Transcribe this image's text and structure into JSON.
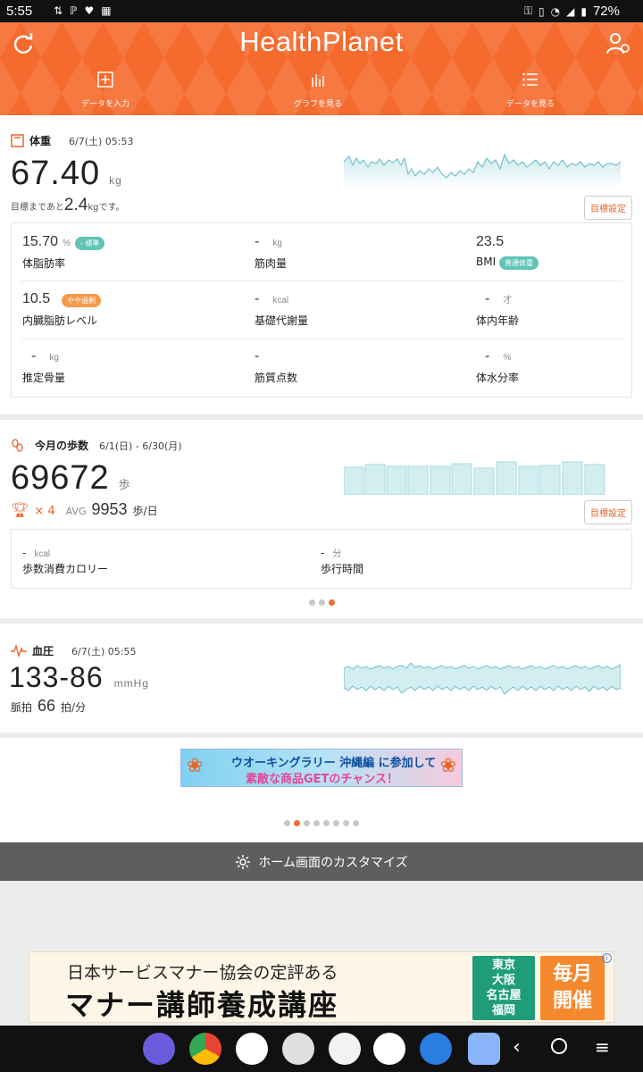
{
  "status_bar": {
    "time": "5:55",
    "battery": "72%"
  },
  "header": {
    "brand": "HealthPlanet",
    "nav": [
      {
        "label": "データを入力"
      },
      {
        "label": "グラフを見る"
      },
      {
        "label": "データを見る"
      }
    ]
  },
  "weight": {
    "title": "体重",
    "date": "6/7(土) 05:53",
    "value": "67.40",
    "unit": "kg",
    "goal_prefix": "目標まであと",
    "goal_value": "2.4",
    "goal_unit": "kg",
    "goal_suffix": "です。",
    "goal_button": "目標設定",
    "metrics": [
      {
        "value": "15.70",
        "unit": "%",
        "badge": "- 標準",
        "label": "体脂肪率"
      },
      {
        "value": "-",
        "unit": "kg",
        "label": "筋肉量"
      },
      {
        "value": "23.5",
        "unit": "",
        "label": "BMI",
        "badge": "普通体重"
      },
      {
        "value": "10.5",
        "unit": "",
        "badge": "やや過剰",
        "label": "内臓脂肪レベル"
      },
      {
        "value": "-",
        "unit": "kcal",
        "label": "基礎代謝量"
      },
      {
        "value": "-",
        "unit": "才",
        "label": "体内年齢"
      },
      {
        "value": "-",
        "unit": "kg",
        "label": "推定骨量"
      },
      {
        "value": "-",
        "unit": "",
        "label": "筋質点数"
      },
      {
        "value": "-",
        "unit": "%",
        "label": "体水分率"
      }
    ]
  },
  "steps": {
    "title": "今月の歩数",
    "date": "6/1(日) - 6/30(月)",
    "value": "69672",
    "unit": "歩",
    "trophy_count": "× 4",
    "avg_label": "AVG",
    "avg_value": "9953",
    "avg_unit": "歩/日",
    "goal_button": "目標設定",
    "metrics": [
      {
        "value": "-",
        "unit": "kcal",
        "label": "歩数消費カロリー"
      },
      {
        "value": "-",
        "unit": "分",
        "label": "歩行時間"
      }
    ]
  },
  "blood_pressure": {
    "title": "血圧",
    "date": "6/7(土) 05:55",
    "value": "133-86",
    "unit": "mmHg",
    "pulse_label": "脈拍",
    "pulse_value": "66",
    "pulse_unit": "拍/分"
  },
  "ad_small": {
    "line1": "ウオーキングラリー 沖縄編 に参加して",
    "line2": "素敵な商品GETのチャンス！"
  },
  "customize": {
    "label": "ホーム画面のカスタマイズ"
  },
  "ad_banner": {
    "line1": "日本サービスマナー協会の定評ある",
    "line2": "マナー講師養成講座",
    "cities": [
      "東京",
      "大阪",
      "名古屋",
      "福岡"
    ],
    "monthly": [
      "毎月",
      "開催"
    ]
  },
  "colors": {
    "accent": "#f56a2d",
    "teal": "#62c4b5",
    "badge_orange": "#f39a4c"
  }
}
